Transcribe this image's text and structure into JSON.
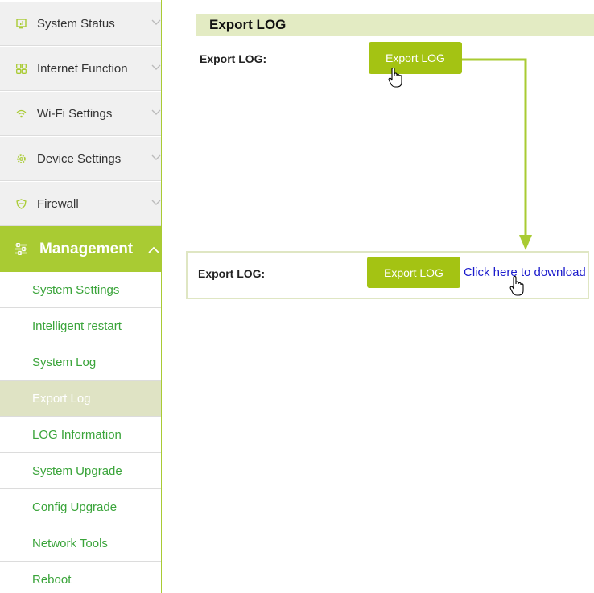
{
  "sidebar": {
    "items": [
      {
        "label": "System Status",
        "icon": "monitor-icon"
      },
      {
        "label": "Internet Function",
        "icon": "grid-icon"
      },
      {
        "label": "Wi-Fi Settings",
        "icon": "wifi-icon"
      },
      {
        "label": "Device Settings",
        "icon": "gear-icon"
      },
      {
        "label": "Firewall",
        "icon": "shield-icon"
      }
    ],
    "management": {
      "label": "Management",
      "icon": "sliders-icon"
    },
    "submenu": [
      {
        "label": "System Settings"
      },
      {
        "label": "Intelligent restart"
      },
      {
        "label": "System Log"
      },
      {
        "label": "Export Log",
        "active": true
      },
      {
        "label": "LOG Information"
      },
      {
        "label": "System Upgrade"
      },
      {
        "label": "Config Upgrade"
      },
      {
        "label": "Network Tools"
      },
      {
        "label": "Reboot"
      }
    ]
  },
  "main": {
    "section_title": "Export LOG",
    "field_label": "Export LOG:",
    "button_label": "Export LOG",
    "result": {
      "field_label": "Export LOG:",
      "button_label": "Export LOG",
      "download_link": "Click here to download"
    }
  },
  "colors": {
    "accent": "#a9cb33",
    "button": "#a4c313",
    "submenu_text": "#3aa43a",
    "active_bg": "#dfe3c4",
    "link": "#1a1acc"
  }
}
